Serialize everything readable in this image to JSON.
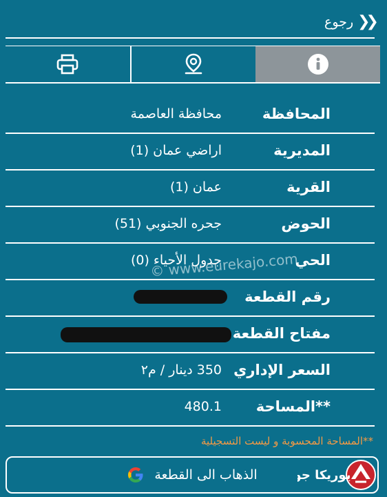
{
  "header": {
    "back_label": "رجوع"
  },
  "tabs": [
    {
      "name": "info",
      "icon": "info-icon"
    },
    {
      "name": "location",
      "icon": "location-pin-icon"
    },
    {
      "name": "print",
      "icon": "printer-icon"
    }
  ],
  "details": [
    {
      "label": "المحافظة",
      "value": "محافظة العاصمة"
    },
    {
      "label": "المديرية",
      "value": "اراضي عمان (1)"
    },
    {
      "label": "القرية",
      "value": "عمان (1)"
    },
    {
      "label": "الحوض",
      "value": "جحره الجنوبي (51)"
    },
    {
      "label": "الحي",
      "value": "جدول الأحياء (0)"
    },
    {
      "label": "رقم القطعة",
      "value": ""
    },
    {
      "label": "مفتاح القطعة",
      "value": ""
    },
    {
      "label": "السعر الإداري",
      "value": "350 دينار / م٢"
    },
    {
      "label": "**المساحة",
      "value": "480.1"
    }
  ],
  "note": "**المساحة المحسوبة و ليست التسجيلية",
  "goto_button": {
    "label": "الذهاب الى القطعة",
    "icon": "google-icon"
  },
  "watermark": "© www.eurekajo.com",
  "logo": {
    "text": "يوريكا جو"
  },
  "colors": {
    "background": "#0b6f8c",
    "active_tab": "#8d959a",
    "note": "#f39a45"
  }
}
